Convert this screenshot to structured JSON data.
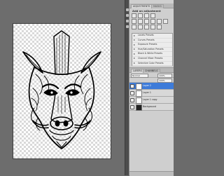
{
  "adjustments_panel": {
    "tabs": [
      "ADJUSTMENTS",
      "MASKS"
    ],
    "title": "Add an adjustment",
    "presets": [
      "Levels Presets",
      "Curves Presets",
      "Exposure Presets",
      "Hue/Saturation Presets",
      "Black & White Presets",
      "Channel Mixer Presets",
      "Selective Color Presets"
    ]
  },
  "layers_panel": {
    "tabs": [
      "LAYERS",
      "CHANNELS"
    ],
    "blend_mode": "Normal",
    "opacity": "100%",
    "fill": "100%",
    "layers": [
      {
        "name": "Layer 2",
        "selected": true
      },
      {
        "name": "Layer 1",
        "selected": false
      },
      {
        "name": "Layer 1 copy",
        "selected": false
      },
      {
        "name": "Background",
        "selected": false
      }
    ]
  },
  "canvas": {
    "artwork": "boar-head-line-art-icon"
  }
}
